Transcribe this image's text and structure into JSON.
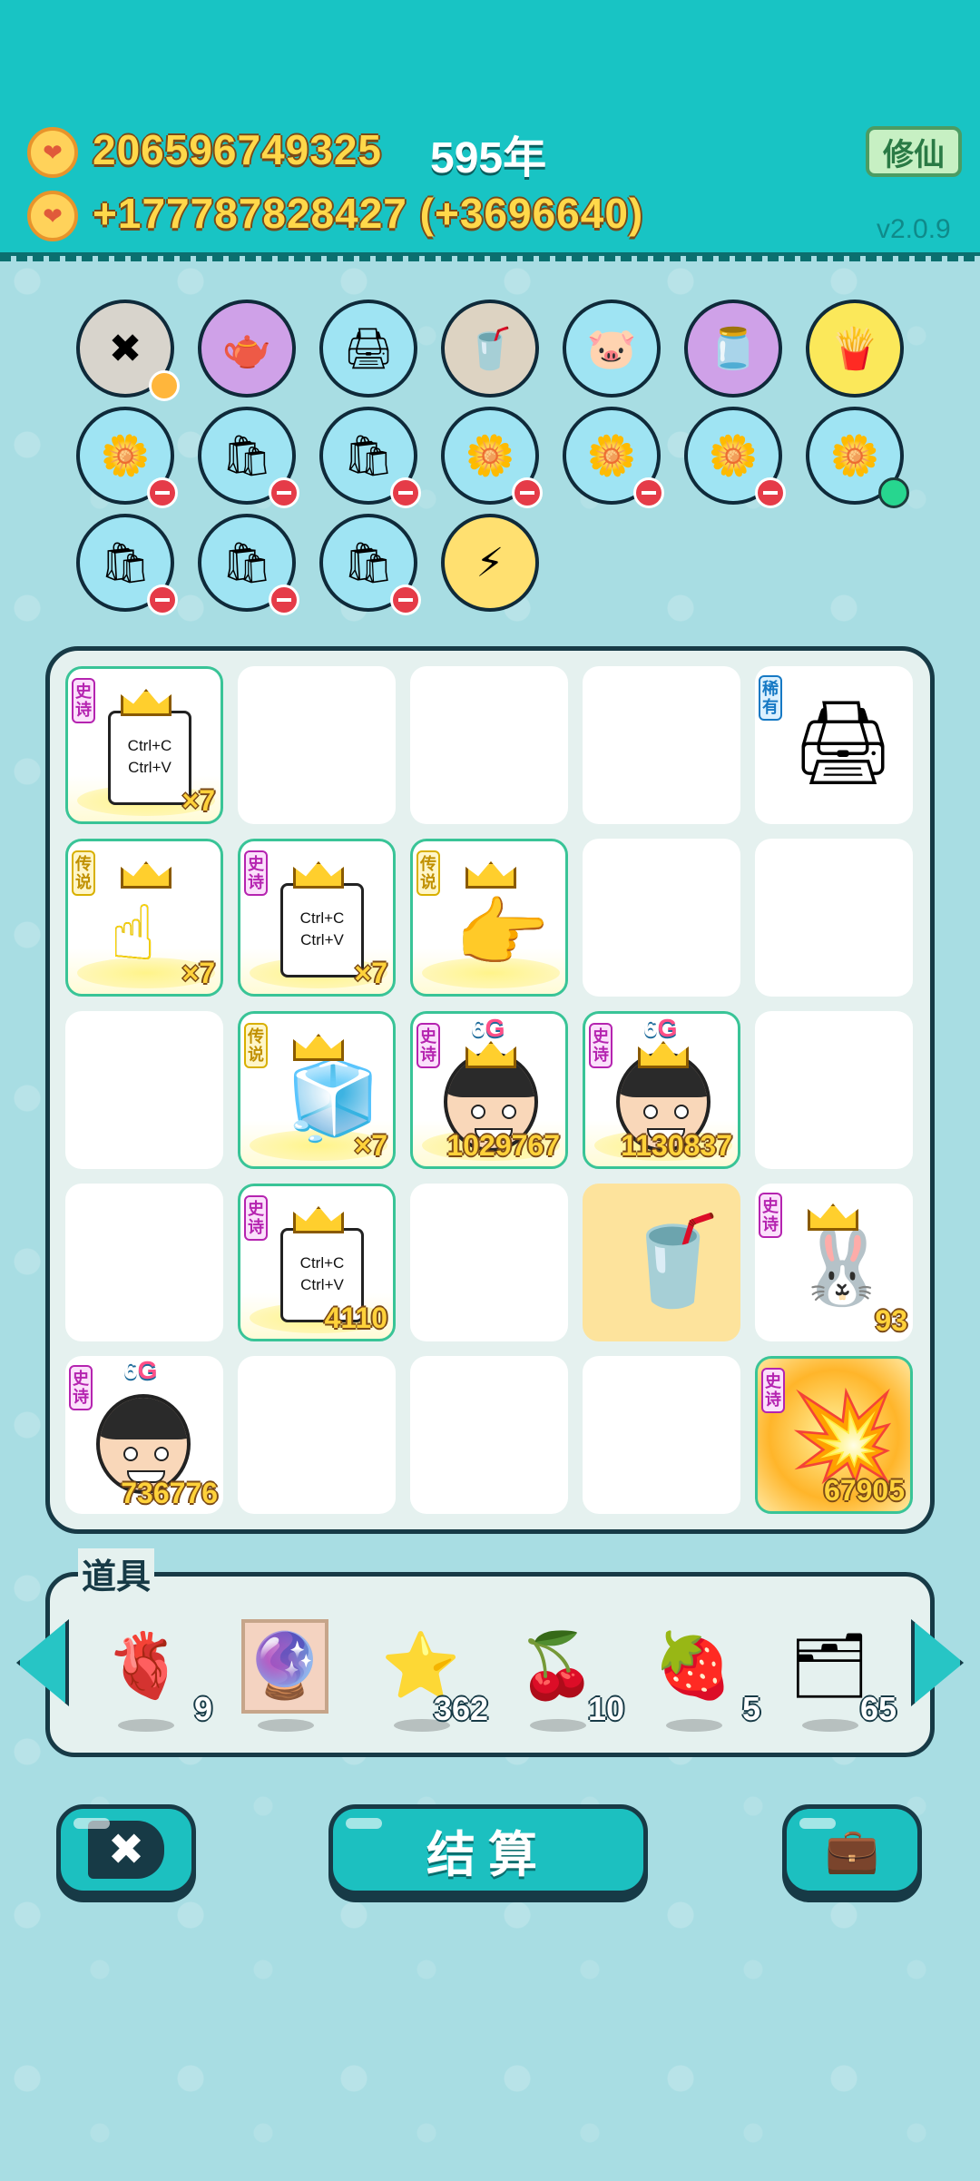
{
  "header": {
    "gold_total": "206596749325",
    "year": "595年",
    "income": "+177787828427 (+3696640)",
    "mode_button": "修仙",
    "version": "v2.0.9"
  },
  "top_items": [
    {
      "icon": "cancel-tag",
      "color": "grey",
      "glyph": "✖"
    },
    {
      "icon": "gravy-boat",
      "color": "purple",
      "glyph": "🫖"
    },
    {
      "icon": "printer",
      "color": "blue",
      "glyph": "🖨"
    },
    {
      "icon": "bubble-tea-cup",
      "color": "tan",
      "glyph": "🥤"
    },
    {
      "icon": "piggy-bank",
      "color": "blue",
      "glyph": "🐷"
    },
    {
      "icon": "jar",
      "color": "purple",
      "glyph": "🫙"
    },
    {
      "icon": "french-fries",
      "color": "yellow",
      "glyph": "🍟"
    }
  ],
  "board": {
    "cells": [
      {
        "tag": "史诗",
        "rarity": "epic",
        "item": "copy-paste-paper",
        "lines": [
          "Ctrl+C",
          "Ctrl+V"
        ],
        "count": "×7"
      },
      {
        "tag": "稀有",
        "rarity": "rare",
        "item": "printer",
        "glyph": "🖨"
      },
      {
        "tag": "传说",
        "rarity": "legend",
        "item": "pointing-hand",
        "glyph": "☝",
        "count": "×7"
      },
      {
        "tag": "史诗",
        "rarity": "epic",
        "item": "copy-paste-paper",
        "lines": [
          "Ctrl+C",
          "Ctrl+V"
        ],
        "count": "×7"
      },
      {
        "tag": "传说",
        "rarity": "legend",
        "item": "pointing-hand-right",
        "glyph": "👉"
      },
      {
        "tag": "传说",
        "rarity": "legend",
        "item": "refrigerator",
        "glyph": "🧊",
        "count": "×7"
      },
      {
        "tag": "史诗",
        "rarity": "epic",
        "item": "face",
        "g": "6",
        "gsuffix": "G",
        "count": "1029767"
      },
      {
        "tag": "史诗",
        "rarity": "epic",
        "item": "face",
        "g": "6",
        "gsuffix": "G",
        "count": "1130837"
      },
      {
        "tag": "史诗",
        "rarity": "epic",
        "item": "copy-paste-paper",
        "lines": [
          "Ctrl+C",
          "Ctrl+V"
        ],
        "count": "4110"
      },
      {
        "item": "bubble-tea-bucket",
        "glyph": "🥤"
      },
      {
        "tag": "史诗",
        "rarity": "epic",
        "item": "rabbit-house",
        "glyph": "🐰",
        "count": "93"
      },
      {
        "tag": "史诗",
        "rarity": "epic",
        "item": "face",
        "g": "6",
        "gsuffix": "G",
        "count": "736776"
      },
      {
        "tag": "史诗",
        "rarity": "epic",
        "item": "explosion",
        "glyph": "💥",
        "count": "67905"
      }
    ]
  },
  "props": {
    "title": "道具",
    "items": [
      {
        "icon": "liver",
        "glyph": "🫀",
        "qty": "9"
      },
      {
        "icon": "crystal-ball-frame",
        "glyph": "🔮",
        "qty": ""
      },
      {
        "icon": "star",
        "glyph": "⭐",
        "qty": "362"
      },
      {
        "icon": "bayberry",
        "glyph": "🍒",
        "qty": "10"
      },
      {
        "icon": "strawberry",
        "glyph": "🍓",
        "qty": "5"
      },
      {
        "icon": "cards",
        "glyph": "🗂",
        "qty": "65"
      }
    ]
  },
  "bottom": {
    "settle_label": "结算",
    "cancel_icon": "✖",
    "bag_icon": "💼"
  },
  "colors": {
    "header_bg": "#18c4c4",
    "page_bg": "#a8dde3",
    "epic": "#b524b0",
    "legend": "#d8b000",
    "rare": "#1679c4",
    "count_gold": "#ffd23a"
  }
}
